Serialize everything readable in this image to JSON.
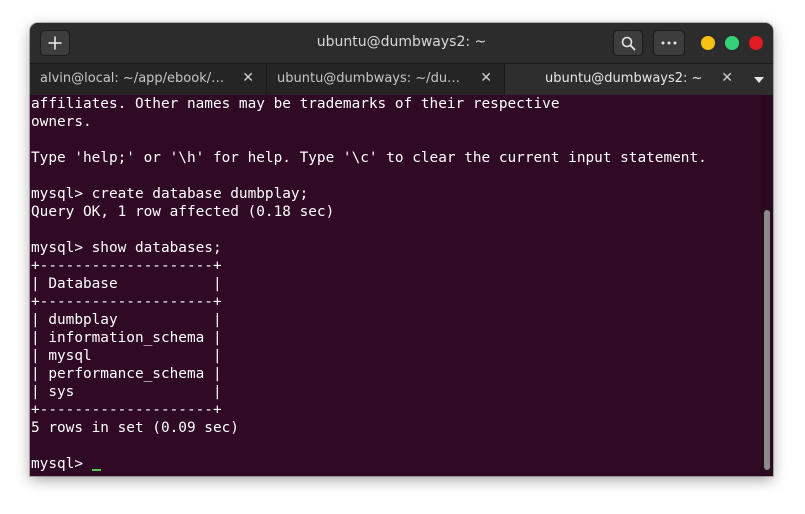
{
  "window": {
    "title": "ubuntu@dumbways2: ~"
  },
  "tabs": [
    {
      "label": "alvin@local: ~/app/ebook/…",
      "close": "✕"
    },
    {
      "label": "ubuntu@dumbways: ~/du…",
      "close": "✕"
    },
    {
      "label": "ubuntu@dumbways2: ~",
      "close": "✕"
    }
  ],
  "icons": {
    "new_tab": "plus-icon",
    "search": "search-icon",
    "menu": "more-icon",
    "tabs_menu": "chevron-down-icon"
  },
  "colors": {
    "terminal_bg": "#300a24",
    "titlebar_bg": "#2c2c2c",
    "minimize": "#f5c211",
    "maximize": "#33d17a",
    "close": "#e01b24",
    "cursor": "#4ec94e"
  },
  "terminal": {
    "lines": [
      "affiliates. Other names may be trademarks of their respective",
      "owners.",
      "",
      "Type 'help;' or '\\h' for help. Type '\\c' to clear the current input statement.",
      "",
      "mysql> create database dumbplay;",
      "Query OK, 1 row affected (0.18 sec)",
      "",
      "mysql> show databases;",
      "+--------------------+",
      "| Database           |",
      "+--------------------+",
      "| dumbplay           |",
      "| information_schema |",
      "| mysql              |",
      "| performance_schema |",
      "| sys                |",
      "+--------------------+",
      "5 rows in set (0.09 sec)",
      ""
    ],
    "prompt": "mysql> "
  }
}
